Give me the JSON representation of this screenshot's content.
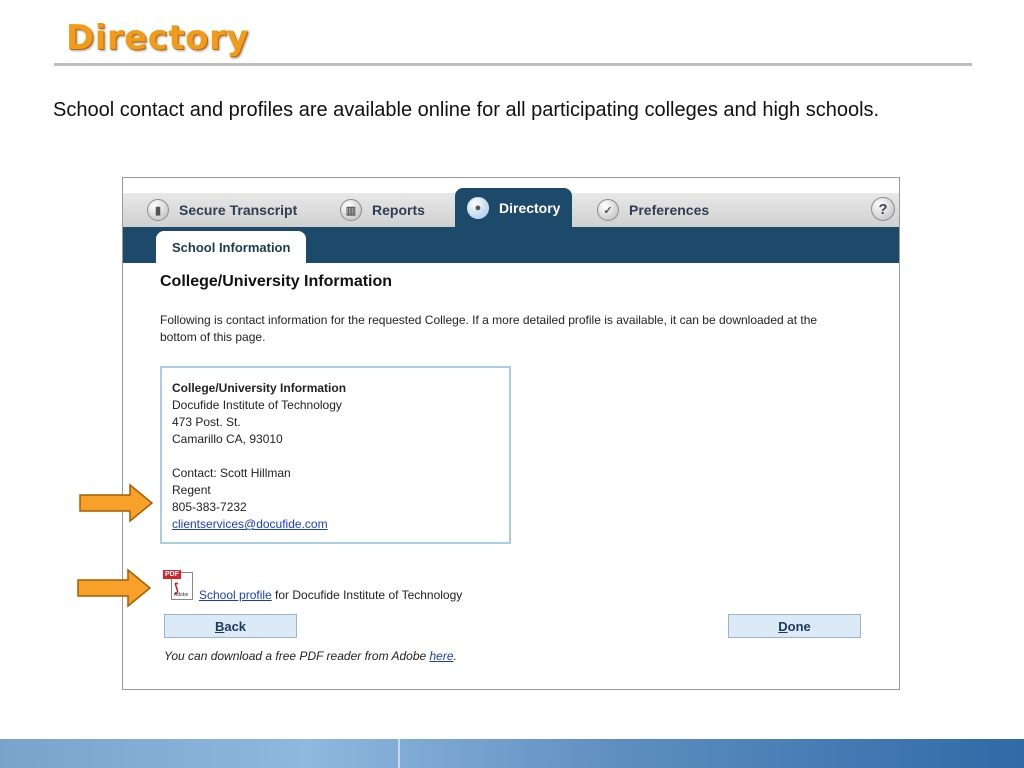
{
  "slide": {
    "title": "Directory",
    "intro": "School contact and profiles are available online for all participating colleges and high schools."
  },
  "tabs": [
    {
      "label": "Secure Transcript",
      "icon": "lock-icon"
    },
    {
      "label": "Reports",
      "icon": "chart-icon"
    },
    {
      "label": "Directory",
      "icon": "person-icon",
      "active": true
    },
    {
      "label": "Preferences",
      "icon": "check-icon"
    }
  ],
  "help_label": "?",
  "subtab": "School Information",
  "section_title": "College/University Information",
  "description": "Following is contact information for the requested College. If a more detailed profile is available, it can be downloaded at the bottom of this page.",
  "info": {
    "heading": "College/University Information",
    "name": "Docufide Institute of Technology",
    "street": "473 Post. St.",
    "city": "Camarillo CA, 93010",
    "contact": "Contact: Scott Hillman",
    "role": "Regent",
    "phone": "805-383-7232",
    "email": "clientservices@docufide.com"
  },
  "pdf": {
    "tag": "PDF",
    "adobe": "Adobe",
    "link": "School profile",
    "suffix": " for Docufide Institute of Technology"
  },
  "buttons": {
    "back_accel": "B",
    "back_rest": "ack",
    "done_accel": "D",
    "done_rest": "one"
  },
  "note": {
    "text": "You can download a free PDF reader from Adobe ",
    "link": "here",
    "end": "."
  },
  "colors": {
    "title_orange": "#f29a1a",
    "nav_blue": "#1d4a6b",
    "arrow_orange": "#f7a12b",
    "link_blue": "#1a3cc8"
  }
}
